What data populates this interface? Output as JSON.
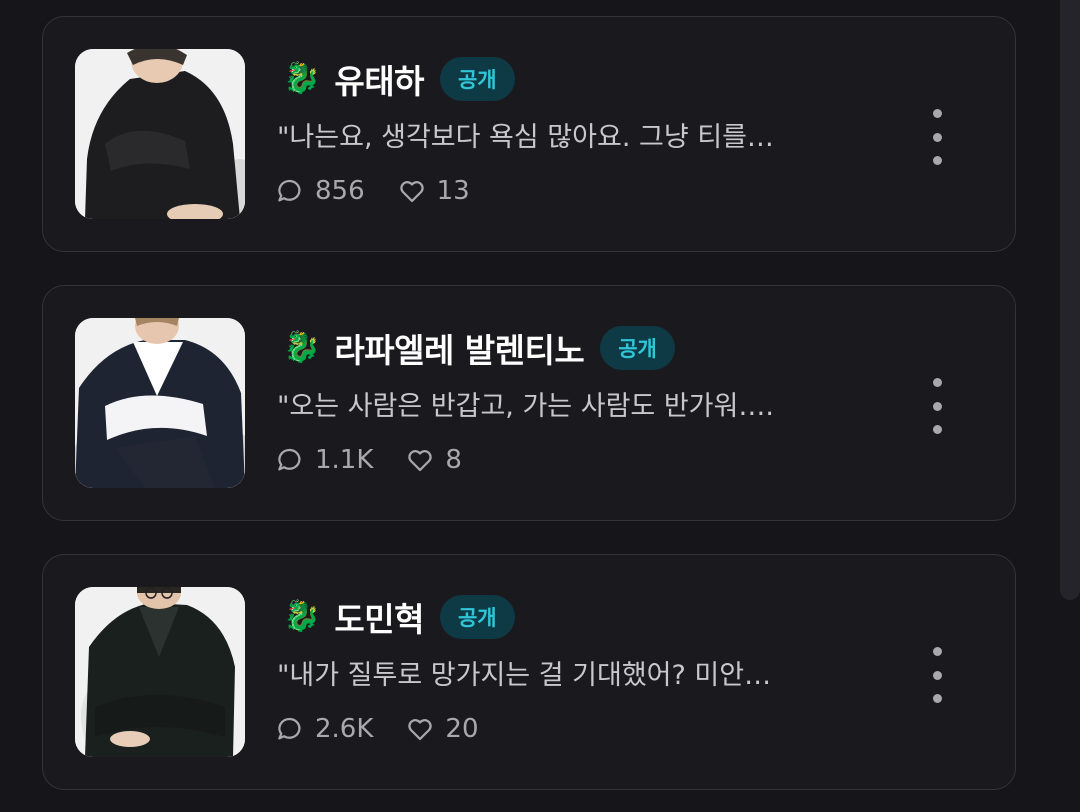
{
  "colors": {
    "background": "#161519",
    "card_border": "#34333a",
    "badge_bg": "#0e3a45",
    "badge_text": "#2fc6d8",
    "muted_text": "#a8a8ad"
  },
  "characters": [
    {
      "icon": "🐉",
      "name": "유태하",
      "badge": "공개",
      "quote": "\"나는요, 생각보다 욕심 많아요. 그냥 티를…",
      "comments": "856",
      "likes": "13"
    },
    {
      "icon": "🐉",
      "name": "라파엘레 발렌티노",
      "badge": "공개",
      "quote": "\"오는 사람은 반갑고, 가는 사람도 반가워….",
      "comments": "1.1K",
      "likes": "8"
    },
    {
      "icon": "🐉",
      "name": "도민혁",
      "badge": "공개",
      "quote": "\"내가 질투로 망가지는 걸 기대했어? 미안…",
      "comments": "2.6K",
      "likes": "20"
    }
  ]
}
